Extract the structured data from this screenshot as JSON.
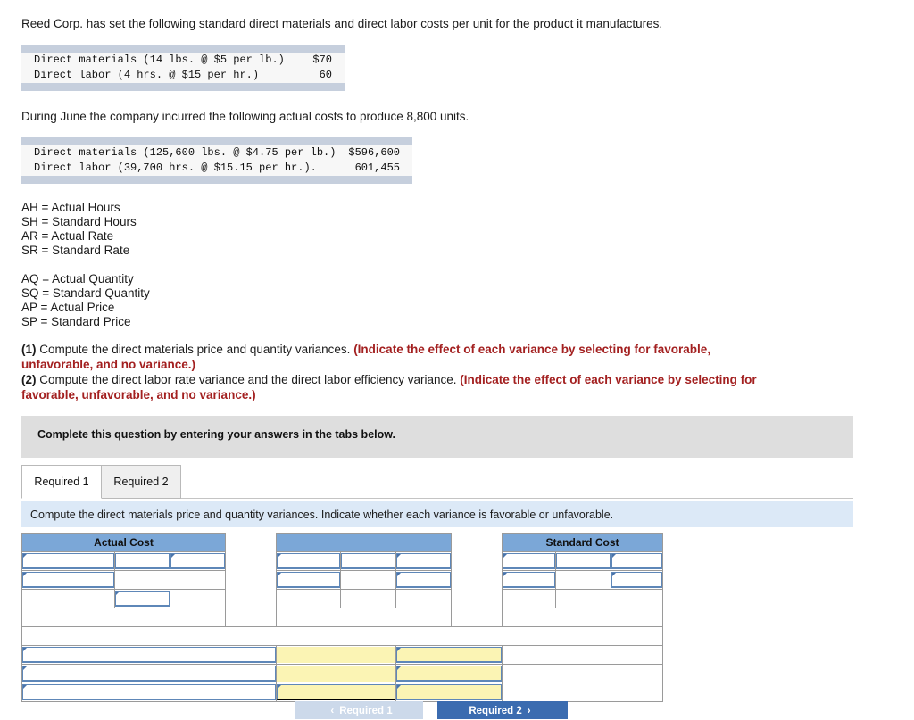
{
  "intro": {
    "line1": "Reed Corp. has set the following standard direct materials and direct labor costs per unit for the product it manufactures.",
    "line2": "During June the company incurred the following actual costs to produce 8,800 units."
  },
  "standard_costs_table": {
    "rows": [
      {
        "label": "Direct materials (14 lbs. @ $5 per lb.)",
        "value": "$70"
      },
      {
        "label": "Direct labor (4 hrs. @ $15 per hr.)",
        "value": "60"
      }
    ]
  },
  "actual_costs_table": {
    "rows": [
      {
        "label": "Direct materials (125,600 lbs. @ $4.75 per lb.)",
        "value": "$596,600"
      },
      {
        "label": "Direct labor (39,700 hrs. @ $15.15 per hr.).",
        "value": "601,455"
      }
    ]
  },
  "legend": {
    "hours_group": [
      "AH = Actual Hours",
      "SH = Standard Hours",
      "AR = Actual Rate",
      "SR = Standard Rate"
    ],
    "quantity_group": [
      "AQ = Actual Quantity",
      "SQ = Standard Quantity",
      "AP = Actual Price",
      "SP = Standard Price"
    ]
  },
  "requirements": [
    {
      "number": "(1)",
      "text": " Compute the direct materials price and quantity variances. ",
      "emphasis": "(Indicate the effect of each variance by selecting for favorable, unfavorable, and no variance.)"
    },
    {
      "number": "(2)",
      "text": " Compute the direct labor rate variance and the direct labor efficiency variance. ",
      "emphasis": "(Indicate the effect of each variance by selecting for favorable, unfavorable, and no variance.)"
    }
  ],
  "complete_banner": {
    "text": "Complete this question by entering your answers in the tabs below."
  },
  "tabs": [
    {
      "label": "Required 1",
      "active": true
    },
    {
      "label": "Required 2",
      "active": false
    }
  ],
  "subinstruction": {
    "text": "Compute the direct materials price and quantity variances. Indicate whether each variance is favorable or unfavorable."
  },
  "answer_grid": {
    "headers": {
      "actual_cost": "Actual Cost",
      "middle": "",
      "standard_cost": "Standard Cost"
    },
    "input_values": {
      "r1c1": "",
      "r1c2": "",
      "r1c3": "",
      "r2c1": "",
      "r2c2": "",
      "r2c3": "",
      "r3c2": "",
      "m1c1": "",
      "m1c2": "",
      "m1c3": "",
      "m2c1": "",
      "m2c2": "",
      "m2c3": "",
      "s1c1": "",
      "s1c2": "",
      "s1c3": "",
      "s2c1": "",
      "s2c2": "",
      "s2c3": "",
      "v1label": "",
      "v1amount": "",
      "v1effect": "",
      "v2label": "",
      "v2amount": "",
      "v2effect": "",
      "v3label": "",
      "v3amount": "",
      "v3effect": ""
    }
  },
  "nav_buttons": {
    "previous": {
      "label": "Required 1",
      "chevron": "‹",
      "enabled": false
    },
    "next": {
      "label": "Required 2",
      "chevron": "›",
      "enabled": true
    }
  },
  "colors": {
    "header_blue": "#7ba7d7",
    "field_border": "#5e87b8",
    "yellow_fill": "#fbf4b4",
    "banner_grey": "#dedede",
    "instruction_blue": "#dce9f7",
    "emphasis_red": "#a32020",
    "primary_button": "#3b6cb0"
  }
}
